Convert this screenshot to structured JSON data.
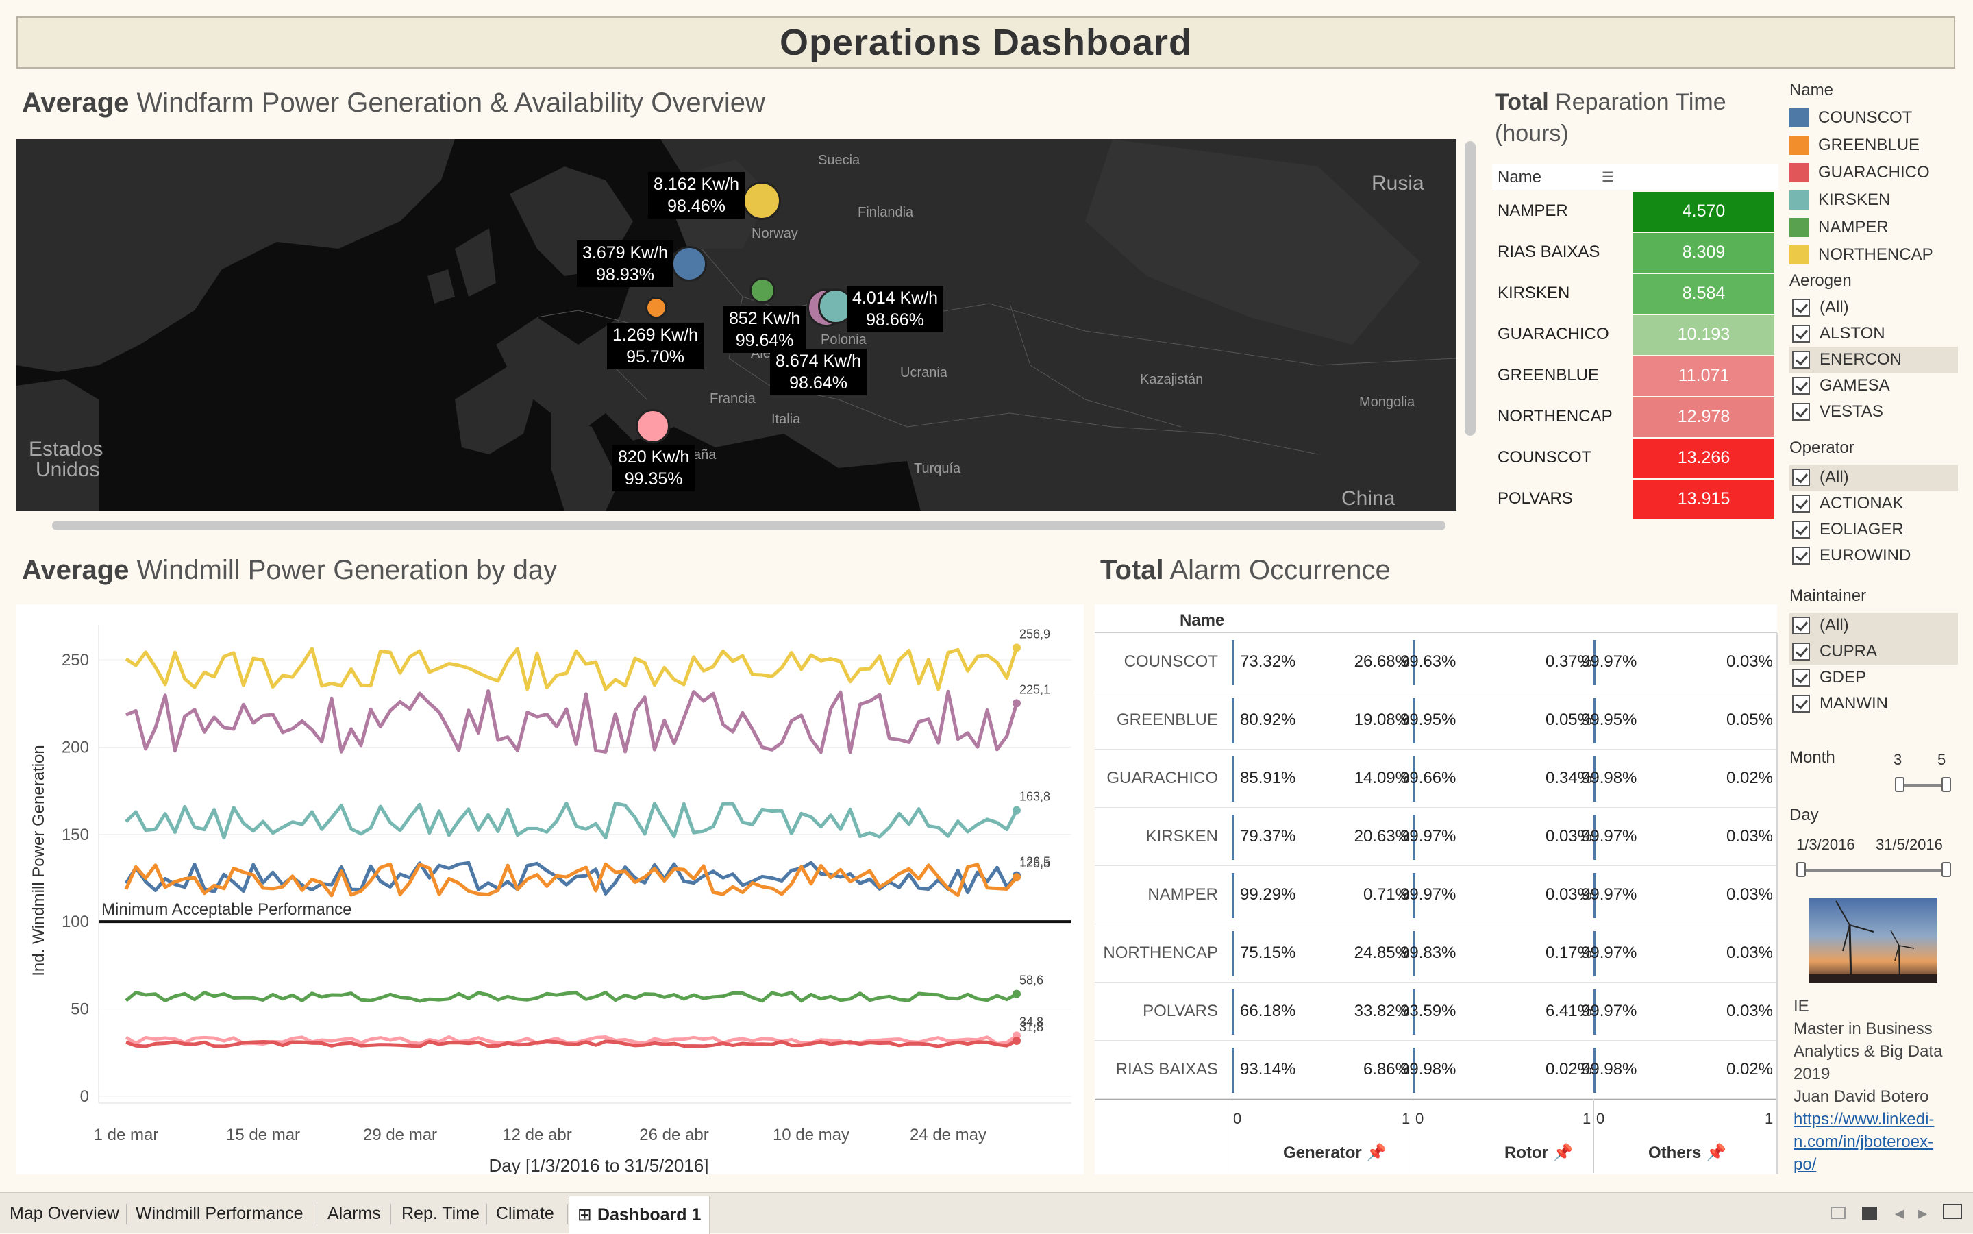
{
  "header": {
    "title": "Operations Dashboard"
  },
  "map_section": {
    "title_bold": "Average",
    "title_rest": "Windfarm Power Generation & Availability Overview",
    "geo_labels": [
      "Suecia",
      "Finlandia",
      "Norway",
      "Rusia",
      "Polonia",
      "Ucrania",
      "Kazajistán",
      "Mongolia",
      "Francia",
      "Italia",
      "Turquía",
      "China",
      "Estados",
      "Unidos",
      "aña",
      "Alem"
    ],
    "bubbles": [
      {
        "name": "NORTHENCAP",
        "power": "8.162 Kw/h",
        "avail": "98.46%",
        "color": "#e8c547"
      },
      {
        "name": "COUNSCOT",
        "power": "3.679 Kw/h",
        "avail": "98.93%",
        "color": "#4e79a7"
      },
      {
        "name": "GREENBLUE",
        "power": "1.269 Kw/h",
        "avail": "95.70%",
        "color": "#f28e2b"
      },
      {
        "name": "NAMPER",
        "power": "852 Kw/h",
        "avail": "99.64%",
        "color": "#59a14f"
      },
      {
        "name": "KIRSKEN",
        "power": "4.014 Kw/h",
        "avail": "98.66%",
        "color": "#76b7b2"
      },
      {
        "name": "RIAS BAIXAS",
        "power": "8.674 Kw/h",
        "avail": "98.64%",
        "color": "#b07aa1"
      },
      {
        "name": "GUARACHICO",
        "power": "820 Kw/h",
        "avail": "99.35%",
        "color": "#ff9da7"
      }
    ]
  },
  "rep_time": {
    "title_bold": "Total",
    "title_rest": "Reparation Time",
    "title_line2": "(hours)",
    "col_header": "Name",
    "rows": [
      {
        "name": "NAMPER",
        "value": "4.570",
        "color": "#138a14"
      },
      {
        "name": "RIAS BAIXAS",
        "value": "8.309",
        "color": "#59b256"
      },
      {
        "name": "KIRSKEN",
        "value": "8.584",
        "color": "#5fb65c"
      },
      {
        "name": "GUARACHICO",
        "value": "10.193",
        "color": "#a2cf96"
      },
      {
        "name": "GREENBLUE",
        "value": "11.071",
        "color": "#ec8585"
      },
      {
        "name": "NORTHENCAP",
        "value": "12.978",
        "color": "#ea7f7f"
      },
      {
        "name": "COUNSCOT",
        "value": "13.266",
        "color": "#f52727"
      },
      {
        "name": "POLVARS",
        "value": "13.915",
        "color": "#f52727"
      }
    ]
  },
  "filters": {
    "name_legend": {
      "title": "Name",
      "items": [
        {
          "label": "COUNSCOT",
          "color": "#4e79a7"
        },
        {
          "label": "GREENBLUE",
          "color": "#f28e2b"
        },
        {
          "label": "GUARACHICO",
          "color": "#e15759"
        },
        {
          "label": "KIRSKEN",
          "color": "#76b7b2"
        },
        {
          "label": "NAMPER",
          "color": "#59a14f"
        },
        {
          "label": "NORTHENCAP",
          "color": "#edc948"
        }
      ]
    },
    "aerogen": {
      "title": "Aerogen",
      "items": [
        "(All)",
        "ALSTON",
        "ENERCON",
        "GAMESA",
        "VESTAS"
      ]
    },
    "operator": {
      "title": "Operator",
      "items": [
        "(All)",
        "ACTIONAK",
        "EOLIAGER",
        "EUROWIND"
      ]
    },
    "maintainer": {
      "title": "Maintainer",
      "items": [
        "(All)",
        "CUPRA",
        "GDEP",
        "MANWIN"
      ]
    },
    "month": {
      "title": "Month",
      "min": "3",
      "max": "5"
    },
    "day": {
      "title": "Day",
      "min": "1/3/2016",
      "max": "31/5/2016"
    }
  },
  "credits": {
    "line1": "IE",
    "line2": "Master in Business",
    "line3": "Analytics & Big Data",
    "line4": "2019",
    "author": "Juan David Botero",
    "link1": "https://www.linkedi-",
    "link2": "n.com/in/jboteroex-",
    "link3": "po/"
  },
  "line_section": {
    "title_bold": "Average",
    "title_rest": "Windmill Power Generation by day",
    "ylabel": "Ind. Windmill Power Generation",
    "xlabel": "Day [1/3/2016 to 31/5/2016]",
    "ref_label": "Minimum Acceptable Performance",
    "x_ticks": [
      "1 de mar",
      "15 de mar",
      "29 de mar",
      "12 de abr",
      "26 de abr",
      "10 de may",
      "24 de may"
    ],
    "y_ticks": [
      "0",
      "50",
      "100",
      "150",
      "200",
      "250"
    ]
  },
  "chart_data": {
    "type": "line",
    "xlabel": "Day [1/3/2016 to 31/5/2016]",
    "ylabel": "Ind. Windmill Power Generation",
    "x_range": [
      "1/3/2016",
      "31/5/2016"
    ],
    "ylim": [
      0,
      270
    ],
    "reference_line": {
      "value": 100,
      "label": "Minimum Acceptable Performance"
    },
    "series": [
      {
        "name": "NORTHENCAP",
        "color": "#edc948",
        "base": 245,
        "amp": 12,
        "end_value": 256.9,
        "end_label": "256,9"
      },
      {
        "name": "RIAS BAIXAS",
        "color": "#b07aa1",
        "base": 215,
        "amp": 18,
        "end_value": 225.1,
        "end_label": "225,1"
      },
      {
        "name": "KIRSKEN",
        "color": "#76b7b2",
        "base": 158,
        "amp": 10,
        "end_value": 163.8,
        "end_label": "163,8"
      },
      {
        "name": "COUNSCOT",
        "color": "#4e79a7",
        "base": 125,
        "amp": 9,
        "end_value": 126.5,
        "end_label": "126,5"
      },
      {
        "name": "GREENBLUE",
        "color": "#f28e2b",
        "base": 124,
        "amp": 9,
        "end_value": 125.5,
        "end_label": "125,5"
      },
      {
        "name": "NAMPER",
        "color": "#59a14f",
        "base": 57,
        "amp": 2.5,
        "end_value": 58.6,
        "end_label": "58,6"
      },
      {
        "name": "GUARACHICO",
        "color": "#ff9da7",
        "base": 32,
        "amp": 2,
        "end_value": 34.8,
        "end_label": "34,8"
      },
      {
        "name": "POLVARS",
        "color": "#e15759",
        "base": 30,
        "amp": 1.5,
        "end_value": 31.8,
        "end_label": "31,8"
      }
    ]
  },
  "alarm_section": {
    "title_bold": "Total",
    "title_rest": "Alarm Occurrence",
    "col_header": "Name",
    "axis_labels": [
      "Generator",
      "Rotor",
      "Others"
    ],
    "axis_ticks": [
      "0",
      "1",
      "0",
      "1",
      "0",
      "1"
    ],
    "rows": [
      {
        "name": "COUNSCOT",
        "v": [
          "73.32%",
          "26.68%",
          "99.63%",
          "0.37%",
          "99.97%",
          "0.03%"
        ]
      },
      {
        "name": "GREENBLUE",
        "v": [
          "80.92%",
          "19.08%",
          "99.95%",
          "0.05%",
          "99.95%",
          "0.05%"
        ]
      },
      {
        "name": "GUARACHICO",
        "v": [
          "85.91%",
          "14.09%",
          "99.66%",
          "0.34%",
          "99.98%",
          "0.02%"
        ]
      },
      {
        "name": "KIRSKEN",
        "v": [
          "79.37%",
          "20.63%",
          "99.97%",
          "0.03%",
          "99.97%",
          "0.03%"
        ]
      },
      {
        "name": "NAMPER",
        "v": [
          "99.29%",
          "0.71%",
          "99.97%",
          "0.03%",
          "99.97%",
          "0.03%"
        ]
      },
      {
        "name": "NORTHENCAP",
        "v": [
          "75.15%",
          "24.85%",
          "99.83%",
          "0.17%",
          "99.97%",
          "0.03%"
        ]
      },
      {
        "name": "POLVARS",
        "v": [
          "66.18%",
          "33.82%",
          "93.59%",
          "6.41%",
          "99.97%",
          "0.03%"
        ]
      },
      {
        "name": "RIAS BAIXAS",
        "v": [
          "93.14%",
          "6.86%",
          "99.98%",
          "0.02%",
          "99.98%",
          "0.02%"
        ]
      }
    ]
  },
  "tabs": [
    "Map Overview",
    "Windmill Performance",
    "Alarms",
    "Rep. Time",
    "Climate",
    "Dashboard 1"
  ],
  "active_tab": "Dashboard 1"
}
